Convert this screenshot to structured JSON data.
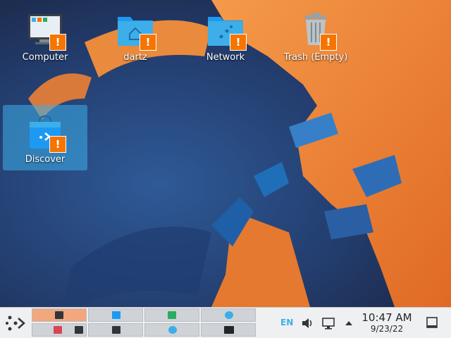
{
  "desktop": {
    "icons": [
      {
        "label": "Computer"
      },
      {
        "label": "dartz"
      },
      {
        "label": "Network"
      },
      {
        "label": "Trash (Empty)"
      },
      {
        "label": "Discover"
      }
    ],
    "badge_glyph": "!",
    "selected_icon": "Discover"
  },
  "panel": {
    "tray": {
      "keyboard_layout": "EN"
    },
    "clock": {
      "time": "10:47 AM",
      "date": "9/23/22"
    }
  },
  "colors": {
    "accent": "#3daee9",
    "warning_badge": "#f67400",
    "panel_bg": "#eff0f1",
    "active_desktop": "#f3a77c",
    "wallpaper_orange": "#f0883a",
    "wallpaper_blue": "#2a5e9e"
  },
  "icons": [
    "application-launcher-icon",
    "speaker-icon",
    "network-icon",
    "arrow-up-icon",
    "show-desktop-icon"
  ]
}
